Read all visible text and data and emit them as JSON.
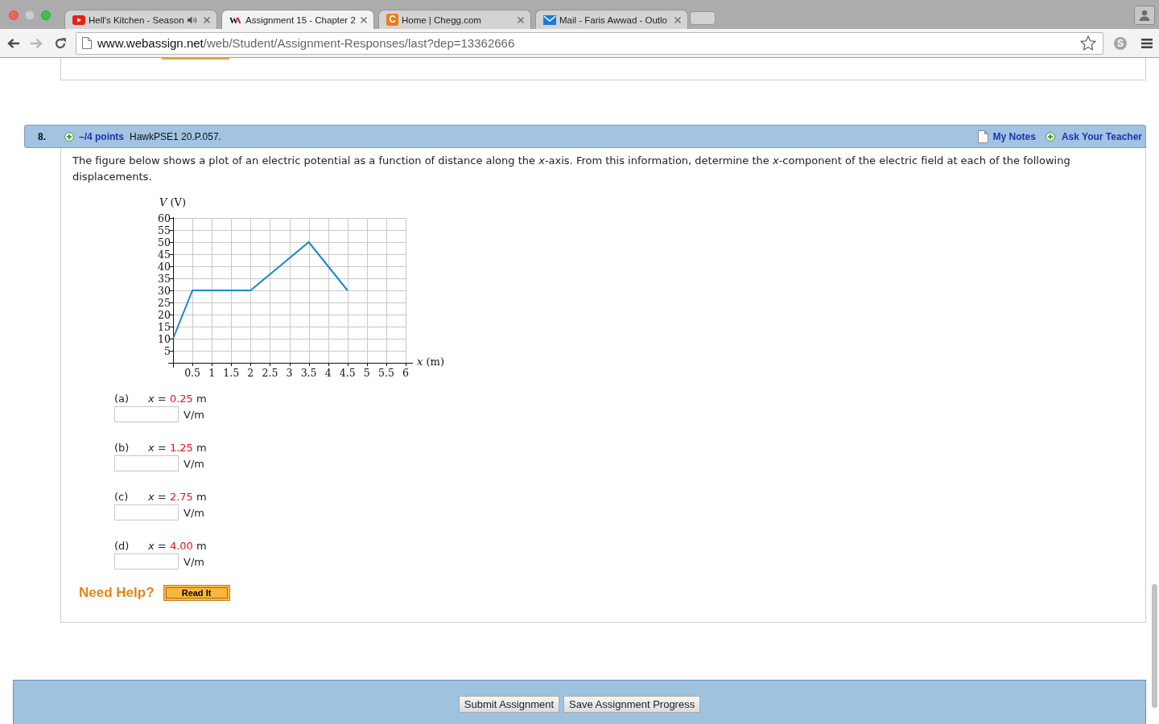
{
  "browser": {
    "tabs": [
      {
        "title": "Hell's Kitchen - Season",
        "kind": "video",
        "audio": true,
        "selected": false
      },
      {
        "title": "Assignment 15 - Chapter 2",
        "kind": "letters",
        "favicon_text": "WA",
        "audio": false,
        "selected": true
      },
      {
        "title": "Home | Chegg.com",
        "kind": "tile",
        "favicon_text": "C",
        "audio": false,
        "selected": false
      },
      {
        "title": "Mail - Faris Awwad - Outlo",
        "kind": "mail",
        "audio": false,
        "selected": false
      }
    ],
    "navigation": {
      "back_disabled": false,
      "forward_disabled": true
    },
    "address": {
      "host": "www.webassign.net",
      "path": "/web/Student/Assignment-Responses/last?dep=13362666"
    },
    "extension_badge": "S"
  },
  "question": {
    "number": "8.",
    "points": "–/4 points",
    "source": "HawkPSE1 20.P.057.",
    "links": [
      {
        "kind": "notes",
        "label": "My Notes"
      },
      {
        "kind": "ask",
        "label": "Ask Your Teacher"
      }
    ],
    "prompt": "The figure below shows a plot of an electric potential as a function of distance along the *x*-axis. From this information, determine the *x*-component of the electric field at each of the following displacements.",
    "chart_data": {
      "type": "line",
      "xlabel": "*x* (m)",
      "ylabel": "*V* (V)",
      "x": [
        0,
        0.5,
        2,
        3.5,
        4.5
      ],
      "series": [
        {
          "color": "#1c87c9",
          "values": [
            10,
            30,
            30,
            50,
            30
          ]
        }
      ],
      "xlim": [
        0,
        6
      ],
      "ylim": [
        0,
        60
      ],
      "xticks": [
        0.5,
        1,
        1.5,
        2,
        2.5,
        3,
        3.5,
        4,
        4.5,
        5,
        5.5,
        6
      ],
      "yticks": [
        5,
        10,
        15,
        20,
        25,
        30,
        35,
        40,
        45,
        50,
        55,
        60
      ],
      "grid": true
    },
    "parts": [
      {
        "label": "(a)",
        "equation": "*x* =",
        "value": "0.25",
        "unit": "m",
        "answer_unit": "V/m"
      },
      {
        "label": "(b)",
        "equation": "*x* =",
        "value": "1.25",
        "unit": "m",
        "answer_unit": "V/m"
      },
      {
        "label": "(c)",
        "equation": "*x* =",
        "value": "2.75",
        "unit": "m",
        "answer_unit": "V/m"
      },
      {
        "label": "(d)",
        "equation": "*x* =",
        "value": "4.00",
        "unit": "m",
        "answer_unit": "V/m"
      }
    ],
    "help": {
      "label": "Need Help?",
      "buttons": [
        "Read It"
      ]
    }
  },
  "actions": [
    "Submit Assignment",
    "Save Assignment Progress"
  ]
}
